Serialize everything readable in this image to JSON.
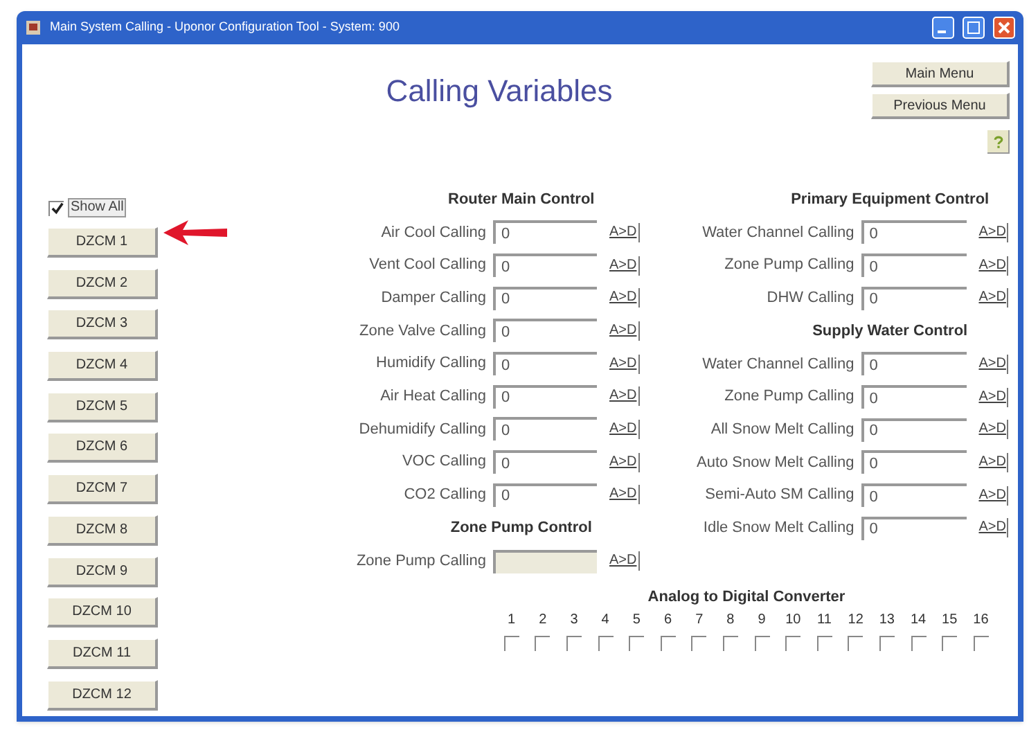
{
  "window": {
    "title": "Main System Calling - Uponor Configuration Tool - System: 900"
  },
  "header": {
    "title": "Calling Variables"
  },
  "nav_buttons": [
    "Main Menu",
    "Previous Menu"
  ],
  "show_all": {
    "label": "Show All",
    "checked": true
  },
  "dzcm_buttons": [
    "DZCM 1",
    "DZCM 2",
    "DZCM 3",
    "DZCM 4",
    "DZCM 5",
    "DZCM 6",
    "DZCM 7",
    "DZCM 8",
    "DZCM 9",
    "DZCM 10",
    "DZCM 11",
    "DZCM 12"
  ],
  "left_column": [
    {
      "title": "Router Main Control",
      "rows": [
        {
          "label": "Air Cool Calling",
          "value": "0",
          "disabled": false,
          "action": "A>D"
        },
        {
          "label": "Vent Cool Calling",
          "value": "0",
          "disabled": false,
          "action": "A>D"
        },
        {
          "label": "Damper Calling",
          "value": "0",
          "disabled": false,
          "action": "A>D"
        },
        {
          "label": "Zone Valve Calling",
          "value": "0",
          "disabled": false,
          "action": "A>D"
        },
        {
          "label": "Humidify Calling",
          "value": "0",
          "disabled": false,
          "action": "A>D"
        },
        {
          "label": "Air Heat Calling",
          "value": "0",
          "disabled": false,
          "action": "A>D"
        },
        {
          "label": "Dehumidify Calling",
          "value": "0",
          "disabled": false,
          "action": "A>D"
        },
        {
          "label": "VOC Calling",
          "value": "0",
          "disabled": false,
          "action": "A>D"
        },
        {
          "label": "CO2 Calling",
          "value": "0",
          "disabled": false,
          "action": "A>D"
        }
      ]
    },
    {
      "title": "Zone Pump Control",
      "rows": [
        {
          "label": "Zone Pump Calling",
          "disabled": true,
          "action": "A>D"
        }
      ]
    }
  ],
  "right_column": [
    {
      "title": "Primary Equipment Control",
      "rows": [
        {
          "label": "Water Channel Calling",
          "value": "0",
          "disabled": false,
          "action": "A>D"
        },
        {
          "label": "Zone Pump Calling",
          "value": "0",
          "disabled": false,
          "action": "A>D"
        },
        {
          "label": "DHW Calling",
          "value": "0",
          "disabled": false,
          "action": "A>D"
        }
      ]
    },
    {
      "title": "Supply Water Control",
      "rows": [
        {
          "label": "Water Channel Calling",
          "value": "0",
          "disabled": false,
          "action": "A>D"
        },
        {
          "label": "Zone Pump Calling",
          "value": "0",
          "disabled": false,
          "action": "A>D"
        },
        {
          "label": "All Snow Melt Calling",
          "value": "0",
          "disabled": false,
          "action": "A>D"
        },
        {
          "label": "Auto Snow Melt Calling",
          "value": "0",
          "disabled": false,
          "action": "A>D"
        },
        {
          "label": "Semi-Auto SM Calling",
          "value": "0",
          "disabled": false,
          "action": "A>D"
        },
        {
          "label": "Idle Snow Melt Calling",
          "value": "0",
          "disabled": false,
          "action": "A>D"
        }
      ]
    }
  ],
  "analog": {
    "title": "Analog to Digital Converter",
    "channels": [
      {
        "label": "1",
        "checked": false
      },
      {
        "label": "2",
        "checked": false
      },
      {
        "label": "3",
        "checked": false
      },
      {
        "label": "4",
        "checked": false
      },
      {
        "label": "5",
        "checked": false
      },
      {
        "label": "6",
        "checked": false
      },
      {
        "label": "7",
        "checked": false
      },
      {
        "label": "8",
        "checked": false
      },
      {
        "label": "9",
        "checked": false
      },
      {
        "label": "10",
        "checked": false
      },
      {
        "label": "11",
        "checked": false
      },
      {
        "label": "12",
        "checked": false
      },
      {
        "label": "13",
        "checked": false
      },
      {
        "label": "14",
        "checked": false
      },
      {
        "label": "15",
        "checked": false
      },
      {
        "label": "16",
        "checked": false
      }
    ]
  }
}
